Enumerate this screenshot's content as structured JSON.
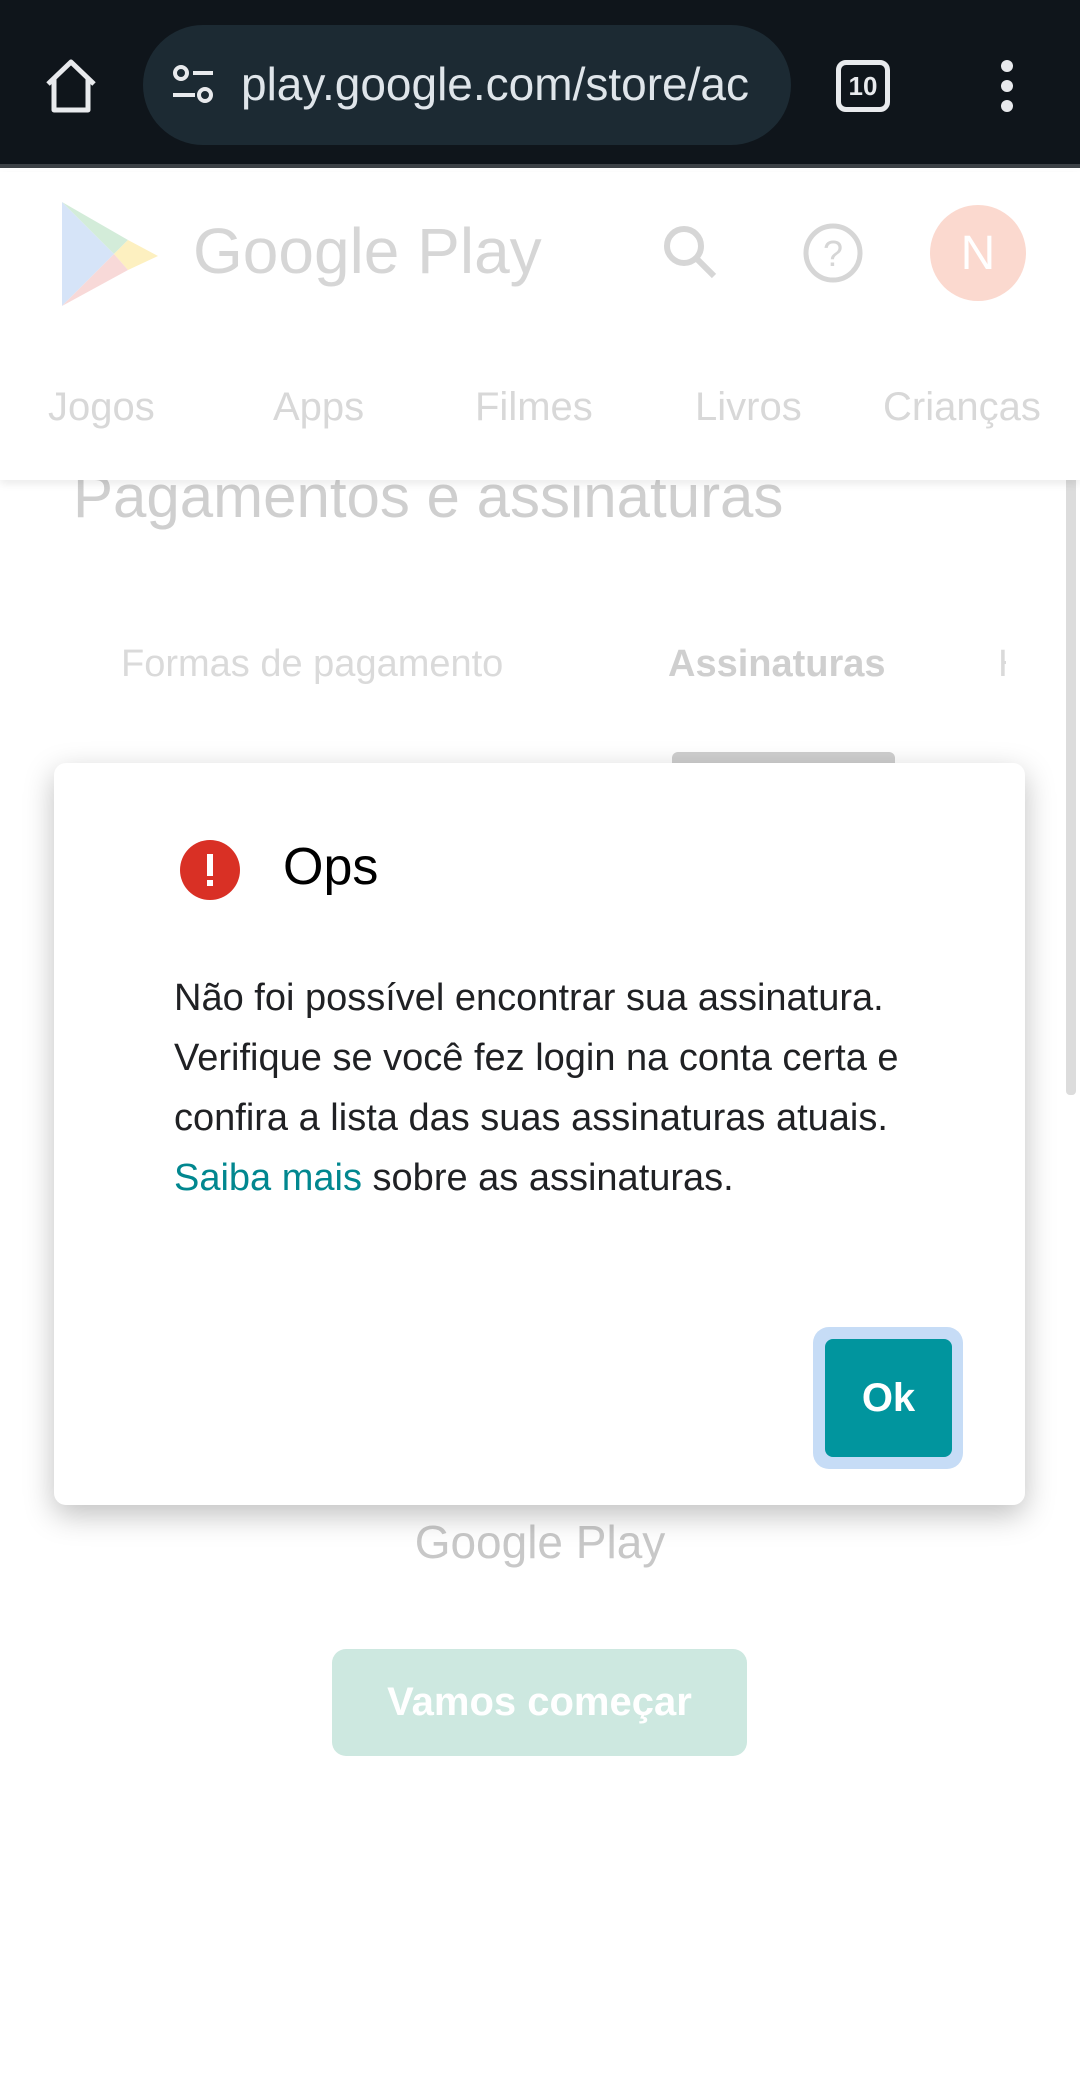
{
  "browser": {
    "url": "play.google.com/store/ac",
    "tab_count": "10",
    "icons": [
      "home-icon",
      "site-settings-icon",
      "tabs-icon",
      "more-vert-icon"
    ]
  },
  "header": {
    "logo_text": "Google Play",
    "avatar_letter": "N",
    "avatar_color": "#fbd9cf",
    "nav": [
      "Jogos",
      "Apps",
      "Filmes",
      "Livros",
      "Crianças"
    ]
  },
  "page": {
    "title": "Pagamentos e assinaturas",
    "subtabs": [
      "Formas de pagamento",
      "Assinaturas",
      "H"
    ],
    "active_subtab": "Assinaturas",
    "footer_logo": "Google Play",
    "cta": "Vamos começar"
  },
  "dialog": {
    "title": "Ops",
    "body": "Não foi possível encontrar sua assinatura. Verifique se você fez login na conta certa e confira a lista das suas assinaturas atuais.",
    "link": "Saiba mais",
    "body_end": "sobre as assinaturas.",
    "ok": "Ok",
    "accent": "#01959e",
    "error_color": "#d93025"
  }
}
